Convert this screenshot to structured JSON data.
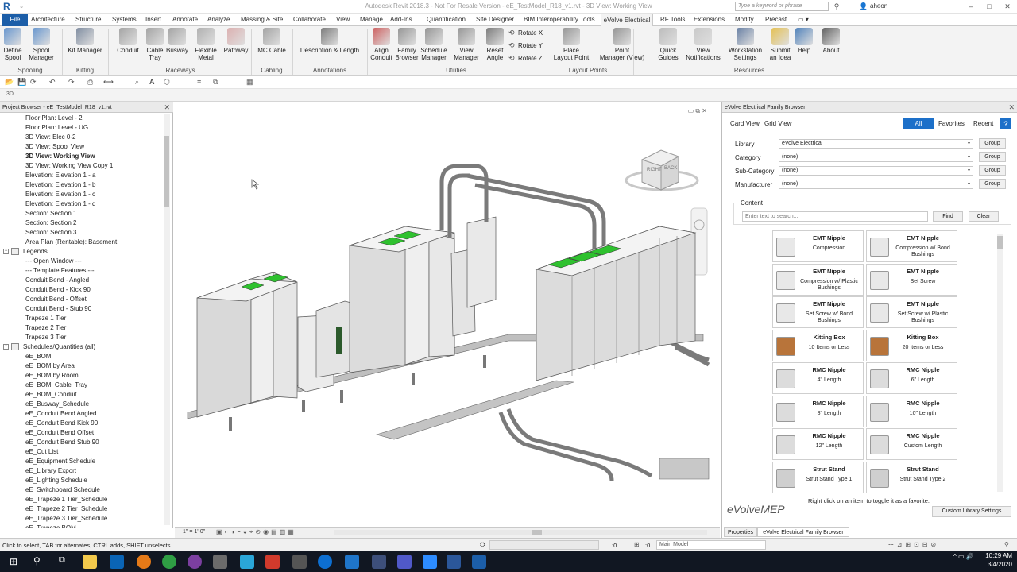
{
  "window": {
    "title": "Autodesk Revit 2018.3 -  Not For Resale Version -     eE_TestModel_R18_v1.rvt - 3D View: Working View",
    "search_placeholder": "Type a keyword or phrase",
    "user": "aheon"
  },
  "tabs": [
    "File",
    "Architecture",
    "Structure",
    "Systems",
    "Insert",
    "Annotate",
    "Analyze",
    "Massing & Site",
    "Collaborate",
    "View",
    "Manage",
    "Add-Ins",
    "Quantification",
    "Site Designer",
    "BIM Interoperability Tools",
    "eVolve Electrical",
    "RF Tools",
    "Extensions",
    "Modify",
    "Precast"
  ],
  "ribbon": {
    "buttons": [
      {
        "label": "Define\nSpool"
      },
      {
        "label": "Spool\nManager"
      },
      {
        "label": "Kit Manager"
      },
      {
        "label": "Conduit"
      },
      {
        "label": "Cable\nTray"
      },
      {
        "label": "Busway"
      },
      {
        "label": "Flexible\nMetal"
      },
      {
        "label": "Pathway"
      },
      {
        "label": "MC Cable"
      },
      {
        "label": "Description & Length"
      },
      {
        "label": "Align\nConduit"
      },
      {
        "label": "Family\nBrowser"
      },
      {
        "label": "Schedule\nManager"
      },
      {
        "label": "View\nManager"
      },
      {
        "label": "Reset\nAngle"
      },
      {
        "label": "Place\nLayout Point"
      },
      {
        "label": "Point\nManager (View)"
      },
      {
        "label": "Quick\nGuides"
      },
      {
        "label": "View\nNotifications"
      },
      {
        "label": "Workstation\nSettings"
      },
      {
        "label": "Submit\nan Idea"
      },
      {
        "label": "Help"
      },
      {
        "label": "About"
      }
    ],
    "rotate": [
      "Rotate X",
      "Rotate Y",
      "Rotate Z"
    ],
    "panels": [
      "Spooling",
      "Kitting",
      "Raceways",
      "Cabling",
      "Annotations",
      "Utilities",
      "Layout Points",
      "Resources"
    ]
  },
  "project_browser": {
    "title": "Project Browser - eE_TestModel_R18_v1.rvt",
    "items": [
      {
        "label": "Floor Plan: Level - 2"
      },
      {
        "label": "Floor Plan: Level - UG"
      },
      {
        "label": "3D View: Elec 0-2"
      },
      {
        "label": "3D View: Spool View"
      },
      {
        "label": "3D View: Working View",
        "selected": true
      },
      {
        "label": "3D View: Working View Copy 1"
      },
      {
        "label": "Elevation: Elevation 1 - a"
      },
      {
        "label": "Elevation: Elevation 1 - b"
      },
      {
        "label": "Elevation: Elevation 1 - c"
      },
      {
        "label": "Elevation: Elevation 1 - d"
      },
      {
        "label": "Section: Section 1"
      },
      {
        "label": "Section: Section 2"
      },
      {
        "label": "Section: Section 3"
      },
      {
        "label": "Area Plan (Rentable): Basement"
      },
      {
        "label": "Legends",
        "group": true
      },
      {
        "label": "---   Open Window   ---"
      },
      {
        "label": "---   Template Features   ---"
      },
      {
        "label": "Conduit Bend - Angled"
      },
      {
        "label": "Conduit Bend - Kick 90"
      },
      {
        "label": "Conduit Bend - Offset"
      },
      {
        "label": "Conduit Bend - Stub 90"
      },
      {
        "label": "Trapeze 1 Tier"
      },
      {
        "label": "Trapeze 2 Tier"
      },
      {
        "label": "Trapeze 3 Tier"
      },
      {
        "label": "Schedules/Quantities (all)",
        "group": true
      },
      {
        "label": "eE_BOM"
      },
      {
        "label": "eE_BOM by Area"
      },
      {
        "label": "eE_BOM by Room"
      },
      {
        "label": "eE_BOM_Cable_Tray"
      },
      {
        "label": "eE_BOM_Conduit"
      },
      {
        "label": "eE_Busway_Schedule"
      },
      {
        "label": "eE_Conduit Bend Angled"
      },
      {
        "label": "eE_Conduit Bend Kick 90"
      },
      {
        "label": "eE_Conduit Bend Offset"
      },
      {
        "label": "eE_Conduit Bend Stub 90"
      },
      {
        "label": "eE_Cut List"
      },
      {
        "label": "eE_Equipment Schedule"
      },
      {
        "label": "eE_Library Export"
      },
      {
        "label": "eE_Lighting Schedule"
      },
      {
        "label": "eE_Switchboard Schedule"
      },
      {
        "label": "eE_Trapeze 1 Tier_Schedule"
      },
      {
        "label": "eE_Trapeze 2 Tier_Schedule"
      },
      {
        "label": "eE_Trapeze 3 Tier_Schedule"
      },
      {
        "label": "eE_Trapeze BOM"
      }
    ]
  },
  "viewport": {
    "scale": "1\" = 1'-0\"",
    "viewcube": [
      "RIGHT",
      "BACK"
    ]
  },
  "family_browser": {
    "title": "eVolve Electrical Family Browser",
    "views": [
      "Card View",
      "Grid View"
    ],
    "filters": [
      "All",
      "Favorites",
      "Recent"
    ],
    "fields": [
      {
        "label": "Library",
        "value": "eVolve Electrical"
      },
      {
        "label": "Category",
        "value": "(none)"
      },
      {
        "label": "Sub-Category",
        "value": "(none)"
      },
      {
        "label": "Manufacturer",
        "value": "(none)"
      }
    ],
    "group_label": "Group",
    "content_label": "Content",
    "search_placeholder": "Enter text to search...",
    "find": "Find",
    "clear": "Clear",
    "cards": [
      {
        "title": "EMT Nipple",
        "sub": "Compression",
        "icon": "emt-nipple-icon"
      },
      {
        "title": "EMT Nipple",
        "sub": "Compression w/ Bond Bushings",
        "icon": "emt-nipple-icon"
      },
      {
        "title": "EMT Nipple",
        "sub": "Compression w/ Plastic Bushings",
        "icon": "emt-nipple-icon"
      },
      {
        "title": "EMT Nipple",
        "sub": "Set Screw",
        "icon": "emt-nipple-icon"
      },
      {
        "title": "EMT Nipple",
        "sub": "Set Screw w/ Bond Bushings",
        "icon": "emt-nipple-icon"
      },
      {
        "title": "EMT Nipple",
        "sub": "Set Screw w/ Plastic Bushings",
        "icon": "emt-nipple-icon"
      },
      {
        "title": "Kitting Box",
        "sub": "10 Items or Less",
        "icon": "box-icon"
      },
      {
        "title": "Kitting Box",
        "sub": "20 Items or Less",
        "icon": "box-icon"
      },
      {
        "title": "RMC Nipple",
        "sub": "4\" Length",
        "icon": "rmc-nipple-icon"
      },
      {
        "title": "RMC Nipple",
        "sub": "6\" Length",
        "icon": "rmc-nipple-icon"
      },
      {
        "title": "RMC Nipple",
        "sub": "8\" Length",
        "icon": "rmc-nipple-icon"
      },
      {
        "title": "RMC Nipple",
        "sub": "10\" Length",
        "icon": "rmc-nipple-icon"
      },
      {
        "title": "RMC Nipple",
        "sub": "12\" Length",
        "icon": "rmc-nipple-icon"
      },
      {
        "title": "RMC Nipple",
        "sub": "Custom Length",
        "icon": "rmc-nipple-icon"
      },
      {
        "title": "Strut Stand",
        "sub": "Strut Stand Type 1",
        "icon": "strut-stand-icon"
      },
      {
        "title": "Strut Stand",
        "sub": "Strut Stand Type 2",
        "icon": "strut-stand-icon"
      }
    ],
    "brand": "eVolveMEP",
    "hint": "Right click on an item to toggle it as a favorite.",
    "custom_settings": "Custom Library Settings",
    "bottom_tabs": [
      "Properties",
      "eVolve Electrical Family Browser"
    ]
  },
  "status": {
    "hint": "Click to select, TAB for alternates, CTRL adds, SHIFT unselects.",
    "zero": ":0",
    "model": "Main Model"
  },
  "taskbar": {
    "time": "10:29 AM",
    "date": "3/4/2020"
  },
  "colors": {
    "file_tab": "#1c5ea8",
    "accent": "#1d70c9",
    "equipment_green": "#2fc12f",
    "taskbar": "#111722"
  }
}
